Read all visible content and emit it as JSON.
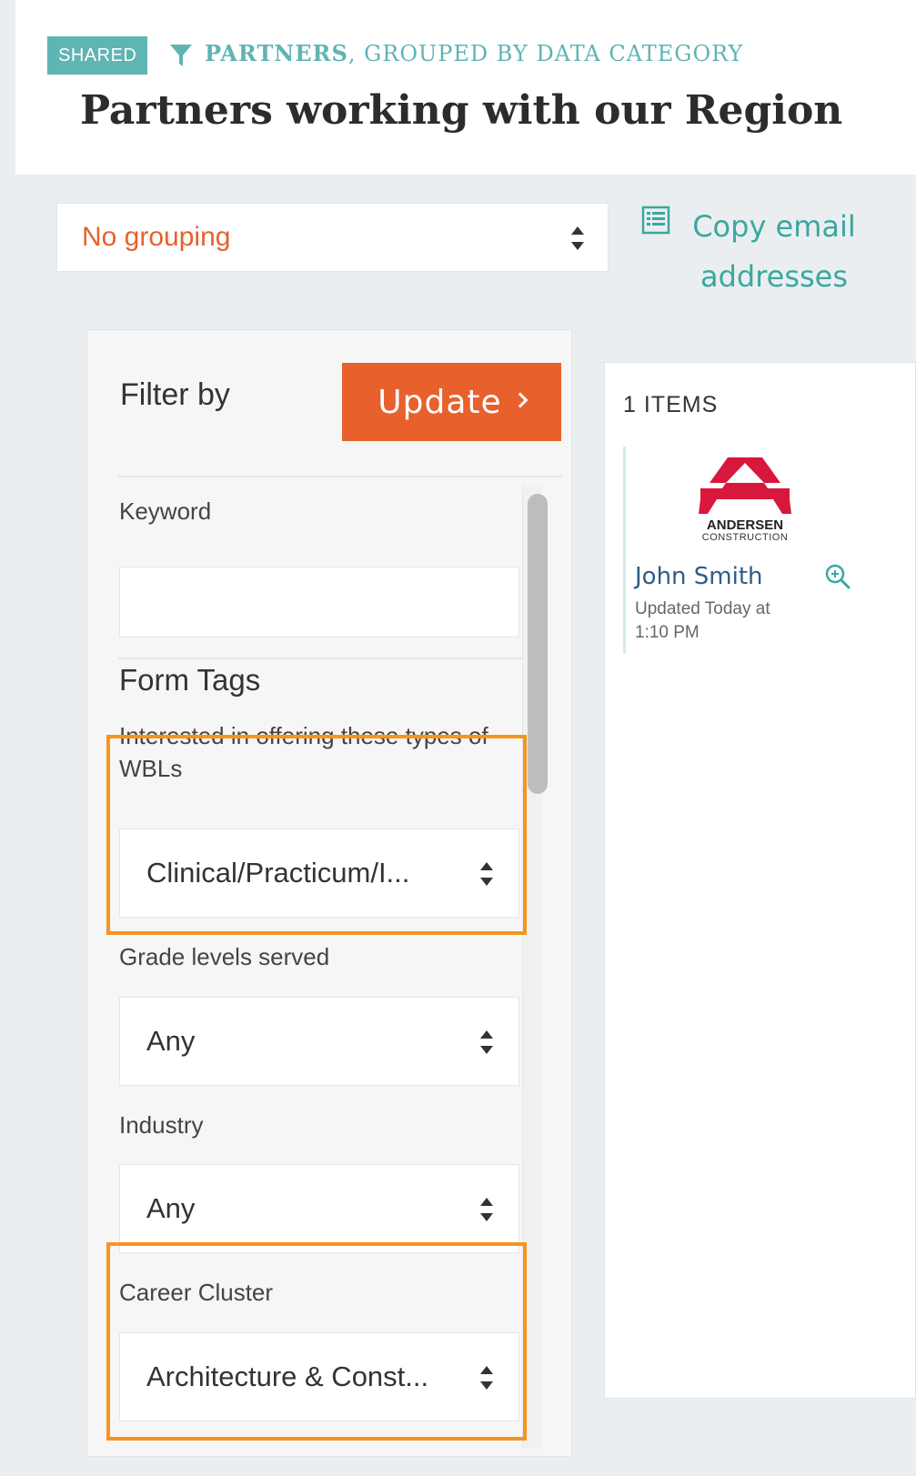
{
  "header": {
    "badge": "SHARED",
    "crumb_strong": "PARTNERS",
    "crumb_rest": ", GROUPED BY DATA CATEGORY",
    "title": "Partners working with our Region",
    "funnel_icon": "funnel-icon"
  },
  "grouping": {
    "selected": "No grouping"
  },
  "copy_email": {
    "label": "Copy email addresses",
    "icon": "list-icon"
  },
  "filter": {
    "title": "Filter by",
    "update_label": "Update",
    "keyword_label": "Keyword",
    "keyword_value": "",
    "form_tags_label": "Form Tags",
    "fields": [
      {
        "label": "Interested in offering these types of WBLs",
        "value": "Clinical/Practicum/I...",
        "highlighted": true
      },
      {
        "label": "Grade levels served",
        "value": "Any",
        "highlighted": false
      },
      {
        "label": "Industry",
        "value": "Any",
        "highlighted": false
      },
      {
        "label": "Career Cluster",
        "value": "Architecture & Const...",
        "highlighted": true
      }
    ],
    "highlight_color": "#f7941d"
  },
  "results": {
    "count_label": "1 ITEMS",
    "items": [
      {
        "logo_name": "ANDERSEN",
        "logo_sub": "CONSTRUCTION",
        "name": "John Smith",
        "updated": "Updated Today at 1:10 PM",
        "icon": "zoom-icon"
      }
    ]
  },
  "colors": {
    "accent": "#e8602c",
    "teal": "#5fb4b4",
    "link": "#2e5c87",
    "logo_red": "#d7173b"
  }
}
